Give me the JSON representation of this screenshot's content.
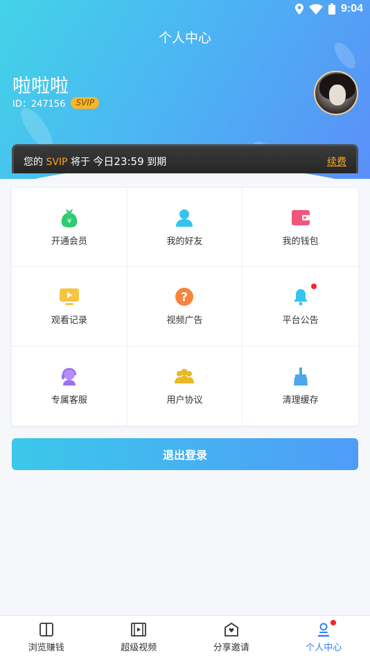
{
  "status_bar": {
    "time": "9:04"
  },
  "header": {
    "title": "个人中心"
  },
  "user": {
    "name": "啦啦啦",
    "id_label": "ID：247156",
    "badge": "SVIP"
  },
  "vip_banner": {
    "prefix": "您的",
    "level": "SVIP",
    "middle": "将于",
    "expire_time": "今日23:59",
    "suffix": "到期",
    "renew_label": "续费"
  },
  "grid": [
    {
      "label": "开通会员",
      "icon": "money-bag-icon",
      "color": "#2ecc71"
    },
    {
      "label": "我的好友",
      "icon": "user-icon",
      "color": "#35c3f0"
    },
    {
      "label": "我的钱包",
      "icon": "wallet-icon",
      "color": "#f0567a"
    },
    {
      "label": "观看记录",
      "icon": "play-screen-icon",
      "color": "#f5c542"
    },
    {
      "label": "视频广告",
      "icon": "question-icon",
      "color": "#f5853f"
    },
    {
      "label": "平台公告",
      "icon": "bell-icon",
      "color": "#35c3f0"
    },
    {
      "label": "专属客服",
      "icon": "headset-icon",
      "color": "#9b6ff2"
    },
    {
      "label": "用户协议",
      "icon": "group-icon",
      "color": "#e8b923"
    },
    {
      "label": "清理缓存",
      "icon": "broom-icon",
      "color": "#4aa8ea"
    }
  ],
  "logout_label": "退出登录",
  "tabs": [
    {
      "label": "浏览赚钱",
      "icon": "book-icon"
    },
    {
      "label": "超级视频",
      "icon": "film-icon"
    },
    {
      "label": "分享邀请",
      "icon": "heart-envelope-icon"
    },
    {
      "label": "个人中心",
      "icon": "profile-icon",
      "active": true
    }
  ],
  "colors": {
    "accent": "#2f7ef7",
    "vip": "#f5a623",
    "notify": "#f5222d"
  }
}
